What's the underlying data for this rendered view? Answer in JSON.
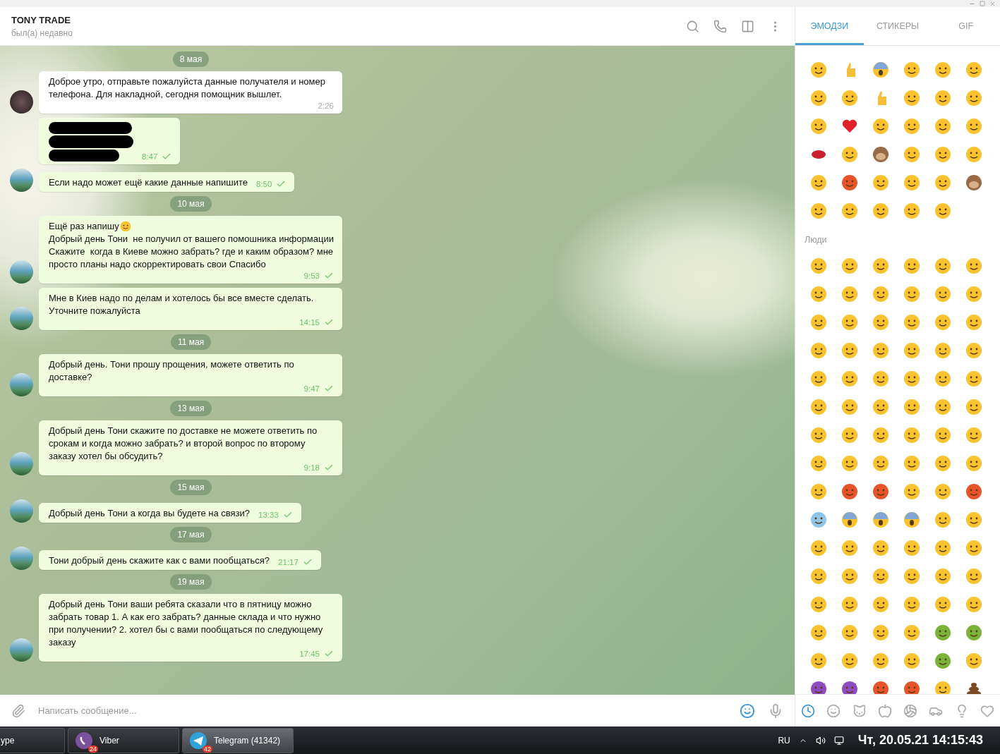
{
  "chat": {
    "title": "TONY TRADE",
    "status": "был(а) недавно"
  },
  "messages": [
    {
      "kind": "date",
      "text": "8 мая"
    },
    {
      "kind": "message",
      "outgoing": false,
      "avatar": true,
      "text": "Доброе утро, отправьте пожалуйста данные получателя и номер телефона. Для накладной, сегодня помощник вышлет.",
      "time": "2:26",
      "read": false
    },
    {
      "kind": "redacted",
      "outgoing": true,
      "avatar": false,
      "time": "8:47",
      "read": true
    },
    {
      "kind": "message",
      "outgoing": true,
      "avatar": true,
      "text": "Если надо может ещё какие данные напишите",
      "time": "8:50",
      "read": true
    },
    {
      "kind": "date",
      "text": "10 мая"
    },
    {
      "kind": "message",
      "outgoing": true,
      "avatar": true,
      "text": "Ещё раз напишу",
      "emoji": true,
      "text2": "Добрый день Тони  не получил от вашего помошника информации Скажите  когда в Киеве можно забрать? где и каким образом? мне просто планы надо скорректировать свои Спасибо",
      "time": "9:53",
      "read": true
    },
    {
      "kind": "message",
      "outgoing": true,
      "avatar": true,
      "text": "Мне в Киев надо по делам и хотелось бы все вместе сделать. Уточните пожалуйста",
      "time": "14:15",
      "read": true
    },
    {
      "kind": "date",
      "text": "11 мая"
    },
    {
      "kind": "message",
      "outgoing": true,
      "avatar": true,
      "text": "Добрый день. Тони прошу прощения, можете ответить по доставке?",
      "time": "9:47",
      "read": true
    },
    {
      "kind": "date",
      "text": "13 мая"
    },
    {
      "kind": "message",
      "outgoing": true,
      "avatar": true,
      "text": "Добрый день Тони скажите по доставке не можете ответить по срокам и когда можно забрать? и второй вопрос по второму заказу хотел бы обсудить?",
      "time": "9:18",
      "read": true
    },
    {
      "kind": "date",
      "text": "15 мая"
    },
    {
      "kind": "message",
      "outgoing": true,
      "avatar": true,
      "text": "Добрый день Тони а когда вы будете на связи?",
      "time": "13:33",
      "read": true
    },
    {
      "kind": "date",
      "text": "17 мая"
    },
    {
      "kind": "message",
      "outgoing": true,
      "avatar": true,
      "text": "Тони добрый день скажите как с вами пообщаться?",
      "time": "21:17",
      "read": true
    },
    {
      "kind": "date",
      "text": "19 мая"
    },
    {
      "kind": "message",
      "outgoing": true,
      "avatar": true,
      "text": "Добрый день Тони ваши ребята сказали что в пятницу можно забрать товар 1. А как его забрать? данные склада и что нужно при получении? 2. хотел бы с вами пообщаться по следующему заказу",
      "time": "17:45",
      "read": true
    }
  ],
  "composer": {
    "placeholder": "Написать сообщение..."
  },
  "emoji_panel": {
    "tabs": [
      {
        "label": "ЭМОДЗИ",
        "selected": true
      },
      {
        "label": "СТИКЕРЫ",
        "selected": false
      },
      {
        "label": "GIF",
        "selected": false
      }
    ],
    "recent": [
      {
        "kind": "face"
      },
      {
        "kind": "hand"
      },
      {
        "kind": "scream"
      },
      {
        "kind": "face"
      },
      {
        "kind": "face"
      },
      {
        "kind": "face"
      },
      {
        "kind": "face"
      },
      {
        "kind": "face"
      },
      {
        "kind": "hand"
      },
      {
        "kind": "face"
      },
      {
        "kind": "face"
      },
      {
        "kind": "face"
      },
      {
        "kind": "face"
      },
      {
        "kind": "heart"
      },
      {
        "kind": "face"
      },
      {
        "kind": "face"
      },
      {
        "kind": "face"
      },
      {
        "kind": "face"
      },
      {
        "kind": "lips"
      },
      {
        "kind": "face"
      },
      {
        "kind": "monkey"
      },
      {
        "kind": "face"
      },
      {
        "kind": "face"
      },
      {
        "kind": "face"
      },
      {
        "kind": "face"
      },
      {
        "kind": "angry"
      },
      {
        "kind": "face"
      },
      {
        "kind": "face"
      },
      {
        "kind": "face"
      },
      {
        "kind": "monkey"
      },
      {
        "kind": "face"
      },
      {
        "kind": "face"
      },
      {
        "kind": "face"
      },
      {
        "kind": "face"
      },
      {
        "kind": "face"
      }
    ],
    "section_title": "Люди",
    "people": [
      {
        "kind": "face"
      },
      {
        "kind": "face"
      },
      {
        "kind": "face"
      },
      {
        "kind": "face"
      },
      {
        "kind": "face"
      },
      {
        "kind": "face"
      },
      {
        "kind": "face"
      },
      {
        "kind": "face"
      },
      {
        "kind": "face"
      },
      {
        "kind": "face"
      },
      {
        "kind": "face"
      },
      {
        "kind": "face"
      },
      {
        "kind": "face"
      },
      {
        "kind": "face"
      },
      {
        "kind": "face"
      },
      {
        "kind": "face"
      },
      {
        "kind": "face"
      },
      {
        "kind": "face"
      },
      {
        "kind": "face"
      },
      {
        "kind": "face"
      },
      {
        "kind": "face"
      },
      {
        "kind": "face"
      },
      {
        "kind": "face"
      },
      {
        "kind": "face"
      },
      {
        "kind": "face"
      },
      {
        "kind": "face"
      },
      {
        "kind": "face"
      },
      {
        "kind": "face"
      },
      {
        "kind": "face"
      },
      {
        "kind": "face"
      },
      {
        "kind": "face"
      },
      {
        "kind": "face"
      },
      {
        "kind": "face"
      },
      {
        "kind": "face"
      },
      {
        "kind": "face"
      },
      {
        "kind": "face"
      },
      {
        "kind": "face"
      },
      {
        "kind": "face"
      },
      {
        "kind": "face"
      },
      {
        "kind": "face"
      },
      {
        "kind": "face"
      },
      {
        "kind": "face"
      },
      {
        "kind": "face"
      },
      {
        "kind": "face"
      },
      {
        "kind": "face"
      },
      {
        "kind": "face"
      },
      {
        "kind": "face"
      },
      {
        "kind": "face"
      },
      {
        "kind": "face"
      },
      {
        "kind": "angry"
      },
      {
        "kind": "angry"
      },
      {
        "kind": "face"
      },
      {
        "kind": "face"
      },
      {
        "kind": "angry"
      },
      {
        "kind": "cold"
      },
      {
        "kind": "scream"
      },
      {
        "kind": "scream"
      },
      {
        "kind": "scream"
      },
      {
        "kind": "face"
      },
      {
        "kind": "face"
      },
      {
        "kind": "face"
      },
      {
        "kind": "face"
      },
      {
        "kind": "face"
      },
      {
        "kind": "face"
      },
      {
        "kind": "face"
      },
      {
        "kind": "face"
      },
      {
        "kind": "face"
      },
      {
        "kind": "face"
      },
      {
        "kind": "face"
      },
      {
        "kind": "face"
      },
      {
        "kind": "face"
      },
      {
        "kind": "face"
      },
      {
        "kind": "face"
      },
      {
        "kind": "face"
      },
      {
        "kind": "face"
      },
      {
        "kind": "face"
      },
      {
        "kind": "face"
      },
      {
        "kind": "face"
      },
      {
        "kind": "face"
      },
      {
        "kind": "face"
      },
      {
        "kind": "face"
      },
      {
        "kind": "face"
      },
      {
        "kind": "sick"
      },
      {
        "kind": "sick"
      },
      {
        "kind": "face"
      },
      {
        "kind": "face"
      },
      {
        "kind": "face"
      },
      {
        "kind": "face"
      },
      {
        "kind": "sick"
      },
      {
        "kind": "cowboy"
      },
      {
        "kind": "devil"
      },
      {
        "kind": "devil"
      },
      {
        "kind": "angry"
      },
      {
        "kind": "angry"
      },
      {
        "kind": "face"
      },
      {
        "kind": "poop"
      }
    ],
    "categories": [
      {
        "kind": "recent",
        "selected": true
      },
      {
        "kind": "smile",
        "selected": false
      },
      {
        "kind": "cat",
        "selected": false
      },
      {
        "kind": "apple",
        "selected": false
      },
      {
        "kind": "ball",
        "selected": false
      },
      {
        "kind": "car",
        "selected": false
      },
      {
        "kind": "bulb",
        "selected": false
      },
      {
        "kind": "heart",
        "selected": false
      }
    ]
  },
  "taskbar": {
    "buttons": [
      {
        "label": "ype",
        "kind": "plain",
        "selected": false
      },
      {
        "label": "Viber",
        "kind": "phone",
        "badge": "24",
        "selected": false
      },
      {
        "label": "Telegram (41342)",
        "kind": "plane",
        "badge": "42",
        "selected": true
      }
    ],
    "language": "RU",
    "clock": "Чт, 20.05.21 14:15:43"
  }
}
